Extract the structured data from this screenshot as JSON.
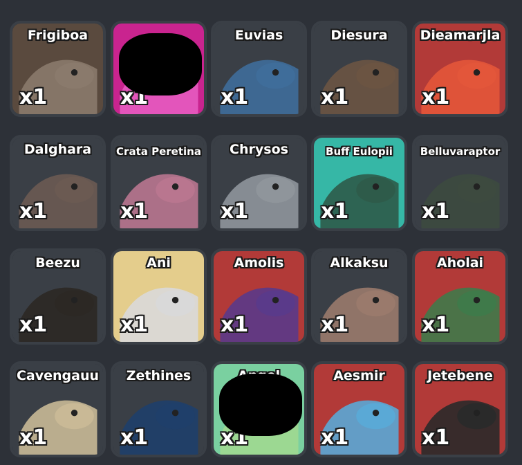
{
  "inventory": {
    "items": [
      {
        "name": "Frigiboa",
        "count": "x1",
        "bg": "#5a4a3e",
        "art": "#8a7a6c"
      },
      {
        "name": "",
        "count": "x1",
        "bg": "#c9248f",
        "art": "#e65bc0"
      },
      {
        "name": "Euvias",
        "count": "x1",
        "bg": "#3a3f46",
        "art": "#3f6d9a"
      },
      {
        "name": "Diesura",
        "count": "x1",
        "bg": "#3a3f46",
        "art": "#6b5442"
      },
      {
        "name": "Dieamarjla",
        "count": "x1",
        "bg": "#b23a38",
        "art": "#e3563a"
      },
      {
        "name": "Dalghara",
        "count": "x1",
        "bg": "#3a3f46",
        "art": "#6b5a52"
      },
      {
        "name": "Crata Peretina",
        "count": "x1",
        "bg": "#3a3f46",
        "art": "#b9768f"
      },
      {
        "name": "Chrysos",
        "count": "x1",
        "bg": "#3a3f46",
        "art": "#8f959b"
      },
      {
        "name": "Buff Eulopii",
        "count": "x1",
        "bg": "#36b7a6",
        "art": "#2e5b4a"
      },
      {
        "name": "Belluvaraptor",
        "count": "x1",
        "bg": "#3a3f46",
        "art": "#3d4a3f"
      },
      {
        "name": "Beezu",
        "count": "x1",
        "bg": "#3a3f46",
        "art": "#2c2824"
      },
      {
        "name": "Ani",
        "count": "x1",
        "bg": "#e4cd8c",
        "art": "#d9d9d9"
      },
      {
        "name": "Amolis",
        "count": "x1",
        "bg": "#b23a38",
        "art": "#5a3a8a"
      },
      {
        "name": "Alkaksu",
        "count": "x1",
        "bg": "#3a3f46",
        "art": "#9a7a6c"
      },
      {
        "name": "Aholai",
        "count": "x1",
        "bg": "#b23a38",
        "art": "#3f7a4a"
      },
      {
        "name": "Cavengauu",
        "count": "x1",
        "bg": "#3a3f46",
        "art": "#c9b996"
      },
      {
        "name": "Zethines",
        "count": "x1",
        "bg": "#3a3f46",
        "art": "#1f3f6a"
      },
      {
        "name": "Angel",
        "count": "x1",
        "bg": "#7ad0a0",
        "art": "#a0d890"
      },
      {
        "name": "Aesmir",
        "count": "x1",
        "bg": "#b23a38",
        "art": "#5aa9d6"
      },
      {
        "name": "Jetebene",
        "count": "x1",
        "bg": "#b23a38",
        "art": "#2a2a2a"
      }
    ]
  }
}
